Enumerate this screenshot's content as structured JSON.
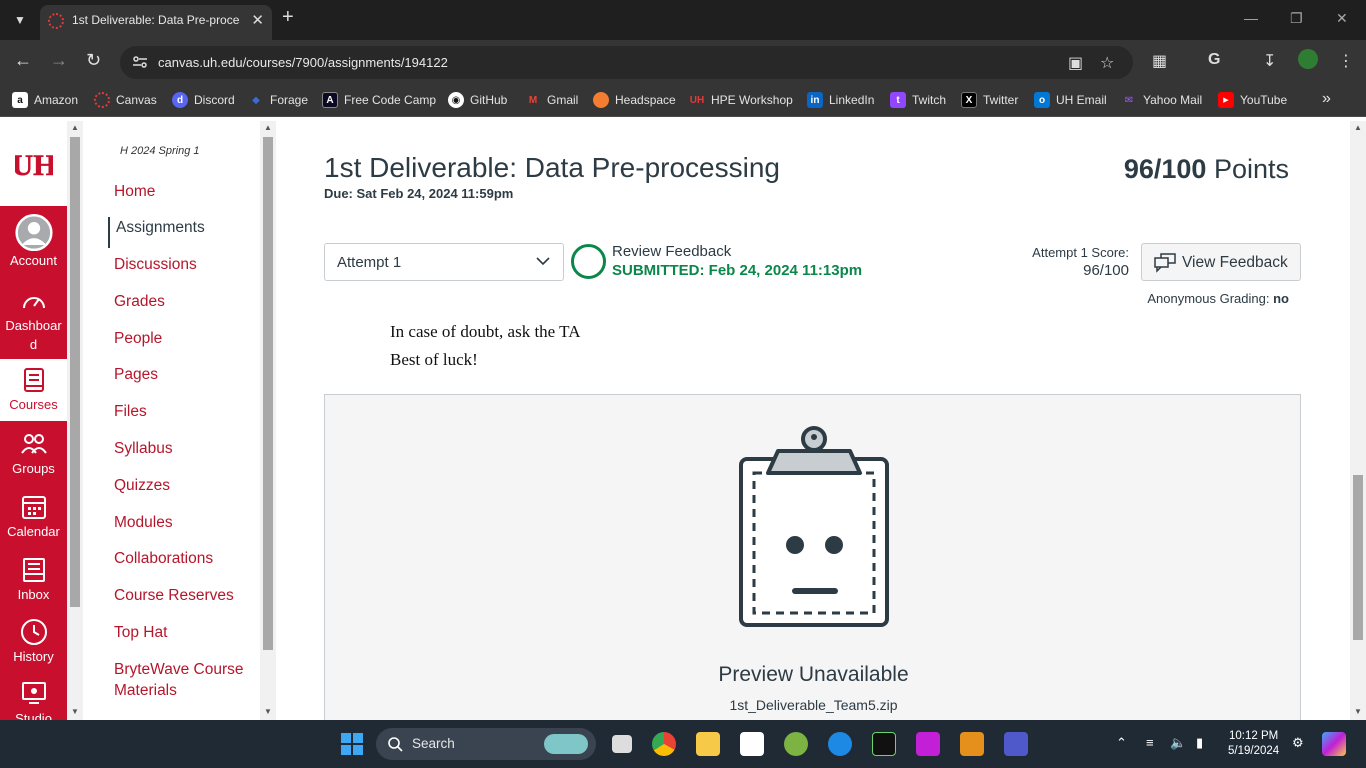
{
  "browser": {
    "tab_title": "1st Deliverable: Data Pre-proces",
    "url": "canvas.uh.edu/courses/7900/assignments/194122",
    "bookmarks": [
      {
        "label": "Amazon",
        "icon": "amazon-icon",
        "color": "#ffffff"
      },
      {
        "label": "Canvas",
        "icon": "canvas-icon",
        "color": "#e23b3b"
      },
      {
        "label": "Discord",
        "icon": "discord-icon",
        "color": "#5865f2"
      },
      {
        "label": "Forage",
        "icon": "forage-icon",
        "color": "#3b6bd6"
      },
      {
        "label": "Free Code Camp",
        "icon": "freecodecamp-icon",
        "color": "#0a0a23"
      },
      {
        "label": "GitHub",
        "icon": "github-icon",
        "color": "#ffffff"
      },
      {
        "label": "Gmail",
        "icon": "gmail-icon",
        "color": "#ea4335"
      },
      {
        "label": "Headspace",
        "icon": "headspace-icon",
        "color": "#f47d31"
      },
      {
        "label": "HPE Workshop",
        "icon": "uh-icon",
        "color": "#c8102e"
      },
      {
        "label": "LinkedIn",
        "icon": "linkedin-icon",
        "color": "#0a66c2"
      },
      {
        "label": "Twitch",
        "icon": "twitch-icon",
        "color": "#9146ff"
      },
      {
        "label": "Twitter",
        "icon": "x-icon",
        "color": "#000000"
      },
      {
        "label": "UH Email",
        "icon": "outlook-icon",
        "color": "#0078d4"
      },
      {
        "label": "Yahoo Mail",
        "icon": "yahoo-icon",
        "color": "#6001d2"
      },
      {
        "label": "YouTube",
        "icon": "youtube-icon",
        "color": "#ff0000"
      }
    ]
  },
  "global_nav": {
    "items": [
      {
        "label": "Account",
        "icon": "account-icon"
      },
      {
        "label": "Dashboar\nd",
        "icon": "dashboard-icon"
      },
      {
        "label": "Courses",
        "icon": "courses-icon"
      },
      {
        "label": "Groups",
        "icon": "groups-icon"
      },
      {
        "label": "Calendar",
        "icon": "calendar-icon"
      },
      {
        "label": "Inbox",
        "icon": "inbox-icon"
      },
      {
        "label": "History",
        "icon": "history-icon"
      },
      {
        "label": "Studio",
        "icon": "studio-icon"
      }
    ],
    "accent": "#c8102e"
  },
  "course_nav": {
    "breadcrumb": "H 2024 Spring 1",
    "items": [
      "Home",
      "Assignments",
      "Discussions",
      "Grades",
      "People",
      "Pages",
      "Files",
      "Syllabus",
      "Quizzes",
      "Modules",
      "Collaborations",
      "Course Reserves",
      "Top Hat",
      "BryteWave Course Materials"
    ],
    "active": "Assignments"
  },
  "assignment": {
    "title": "1st Deliverable: Data Pre-processing",
    "due_label": "Due:",
    "due_value": "Sat Feb 24, 2024 11:59pm",
    "points_score": "96/100",
    "points_label": "Points",
    "attempt_select": "Attempt 1",
    "review_label": "Review Feedback",
    "submitted": "SUBMITTED: Feb 24, 2024 11:13pm",
    "attempt_score_label": "Attempt 1 Score:",
    "attempt_score_value": "96/100",
    "view_feedback_label": "View Feedback",
    "anon_label": "Anonymous Grading:",
    "anon_value": "no",
    "description_lines": [
      "In case of doubt, ask the TA",
      "Best of luck!"
    ],
    "preview_title": "Preview Unavailable",
    "preview_file": "1st_Deliverable_Team5.zip",
    "success_color": "#0b874b"
  },
  "taskbar": {
    "search_placeholder": "Search",
    "time": "10:12 PM",
    "date": "5/19/2024"
  }
}
